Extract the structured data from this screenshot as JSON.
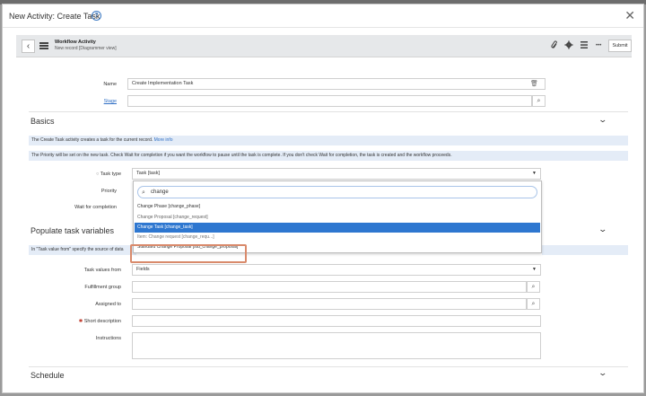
{
  "modal": {
    "title": "New Activity: Create Task",
    "help_icon": "?",
    "close_icon": "✕"
  },
  "record_header": {
    "title": "Workflow Activity",
    "subtitle": "New record [Diagrammer view]",
    "more_label": "•••",
    "submit_label": "Submit",
    "icons": [
      "paperclip-icon",
      "settings-icon",
      "list-icon"
    ]
  },
  "form": {
    "name_label": "Name",
    "name_value": "Create Implementation Task",
    "stage_label": "Stage",
    "stage_value": "",
    "basics_title": "Basics",
    "info_line1": "The Create Task activity creates a task for the current record.",
    "info_more": "More info",
    "info_line2": "The Priority will be set on the new task. Check Wait for completion if you want the workflow to pause until the task is complete. If you don't check Wait for completion, the task is created and the workflow proceeds.",
    "task_type_label": "Task type",
    "task_type_value": "Task [task]",
    "priority_label": "Priority",
    "wait_label": "Wait for completion",
    "populate_title": "Populate task variables",
    "populate_info": "In \"Task value from\" specify the source of data",
    "task_values_label": "Task values from",
    "task_values_value": "Fields",
    "fulfillment_label": "Fulfillment group",
    "assigned_label": "Assigned to",
    "short_desc_label": "Short description",
    "instructions_label": "Instructions",
    "schedule_title": "Schedule"
  },
  "dropdown": {
    "search_value": "change",
    "items": [
      "Change Phase [change_phase]",
      "Change Proposal [change_request]",
      "Change Task [change_task]",
      "Item: Change request [change_requ...]",
      "Standard Change Proposal [std_change_proposal]"
    ],
    "selected_index": 2
  },
  "colors": {
    "accent": "#2e77d0",
    "info_bar": "#e4ecf7",
    "highlight": "#d98a6b",
    "required": "#c0392b"
  }
}
